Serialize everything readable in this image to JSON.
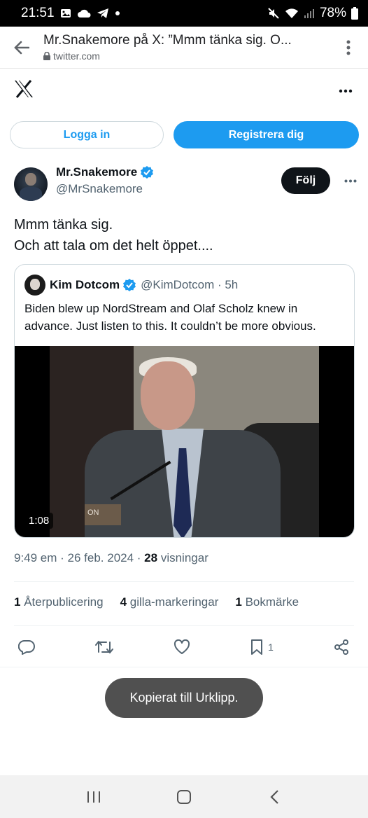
{
  "status_bar": {
    "time": "21:51",
    "battery": "78%"
  },
  "browser": {
    "title": "Mr.Snakemore på X: ”Mmm tänka sig. O...",
    "url": "twitter.com"
  },
  "auth": {
    "login": "Logga in",
    "signup": "Registrera dig"
  },
  "tweet": {
    "author_name": "Mr.Snakemore",
    "author_handle": "@MrSnakemore",
    "follow_label": "Följ",
    "text_line1": "Mmm tänka sig.",
    "text_line2": "Och att tala om det helt öppet....",
    "time_date": "9:49 em · 26 feb. 2024 · ",
    "views_count": "28",
    "views_label": " visningar",
    "reposts_count": "1",
    "reposts_label": " Återpublicering",
    "likes_count": "4",
    "likes_label": " gilla-markeringar",
    "bookmarks_count": "1",
    "bookmarks_label": " Bokmärke",
    "bookmark_action_count": "1"
  },
  "quote": {
    "name": "Kim Dotcom",
    "handle": "@KimDotcom · 5h",
    "text": "Biden blew up NordStream and Olaf Scholz knew in advance. Just listen to this. It couldn’t be more obvious.",
    "video_duration": "1:08",
    "nameplate": "ON"
  },
  "toast": "Kopierat till Urklipp.",
  "colors": {
    "accent": "#1d9bf0",
    "text": "#0f1419",
    "muted": "#536471"
  }
}
